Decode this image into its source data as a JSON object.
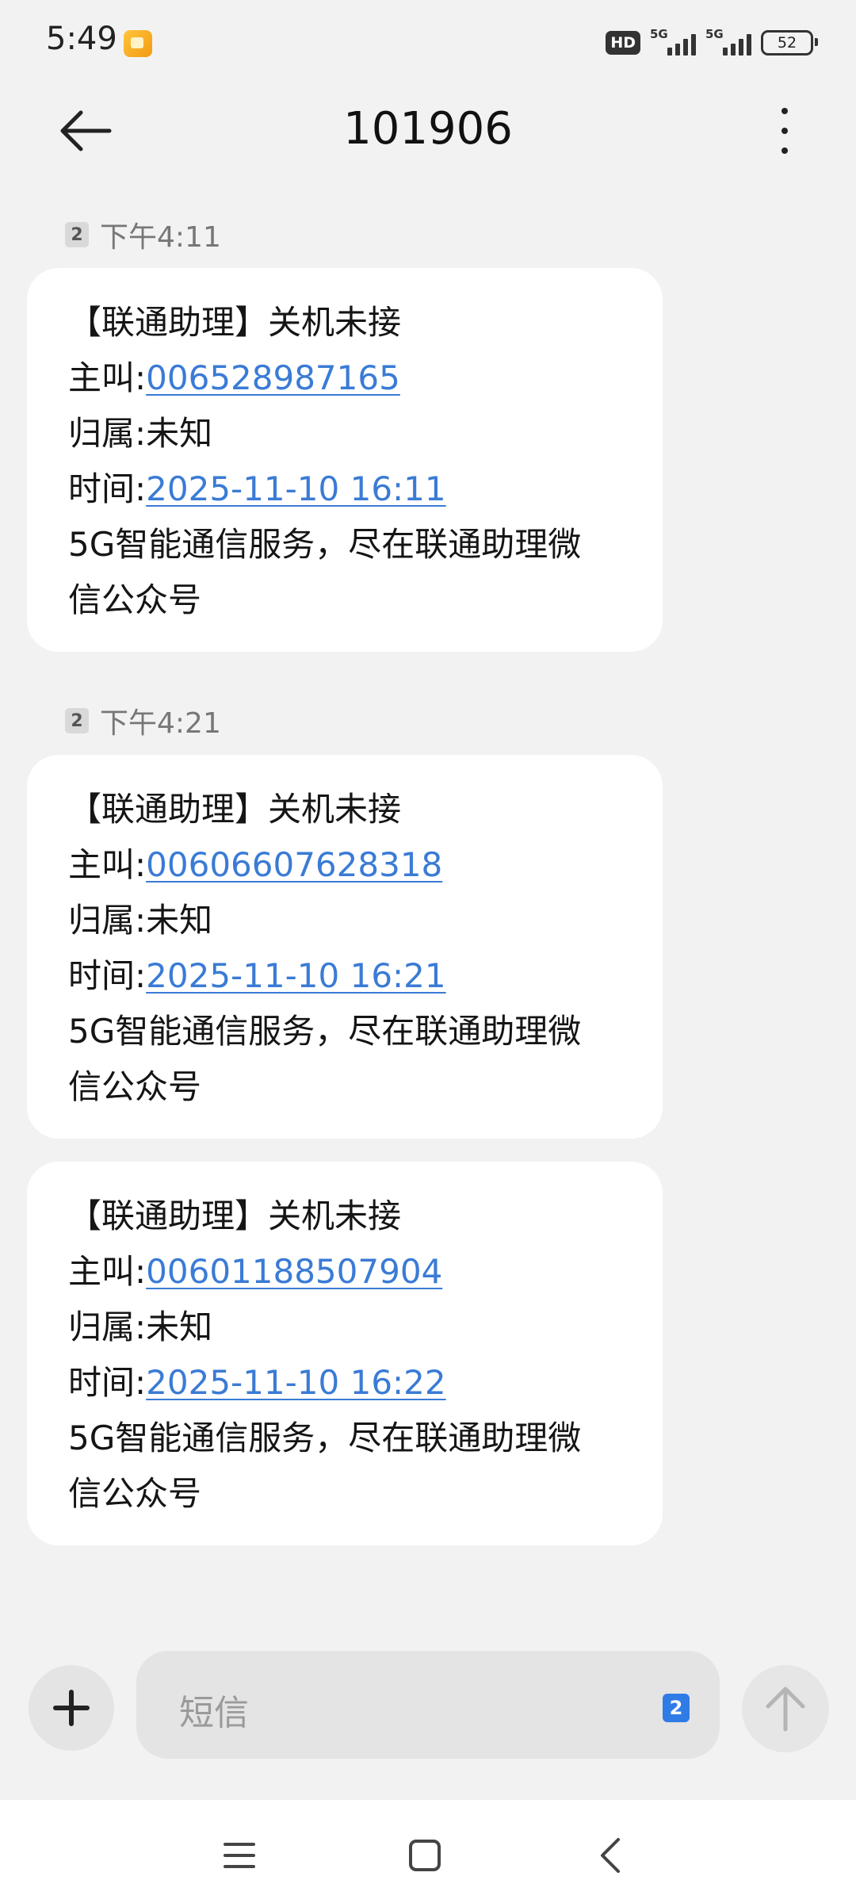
{
  "status_bar": {
    "time": "5:49",
    "network_1": "5G",
    "network_2": "5G",
    "battery": "52",
    "hd_label": "HD"
  },
  "header": {
    "title": "101906"
  },
  "messages": [
    {
      "timestamp": "下午4:11",
      "sim": "2",
      "line1": "【联通助理】关机未接",
      "caller_label": "主叫:",
      "caller_number": "006528987165",
      "location": "归属:未知",
      "time_label": "时间:",
      "time_value": "2025-11-10 16:11",
      "footer_1": "5G智能通信服务，尽在联通助理微",
      "footer_2": "信公众号"
    },
    {
      "timestamp": "下午4:21",
      "sim": "2",
      "line1": "【联通助理】关机未接",
      "caller_label": "主叫:",
      "caller_number": "00606607628318",
      "location": "归属:未知",
      "time_label": "时间:",
      "time_value": "2025-11-10 16:21",
      "footer_1": "5G智能通信服务，尽在联通助理微",
      "footer_2": "信公众号"
    },
    {
      "line1": "【联通助理】关机未接",
      "caller_label": "主叫:",
      "caller_number": "00601188507904",
      "location": "归属:未知",
      "time_label": "时间:",
      "time_value": "2025-11-10 16:22",
      "footer_1": "5G智能通信服务，尽在联通助理微",
      "footer_2": "信公众号"
    }
  ],
  "input": {
    "placeholder": "短信",
    "sim": "2"
  },
  "colors": {
    "link": "#3a7bd5",
    "sim_chip": "#2f7ce6",
    "background": "#f2f2f2"
  }
}
